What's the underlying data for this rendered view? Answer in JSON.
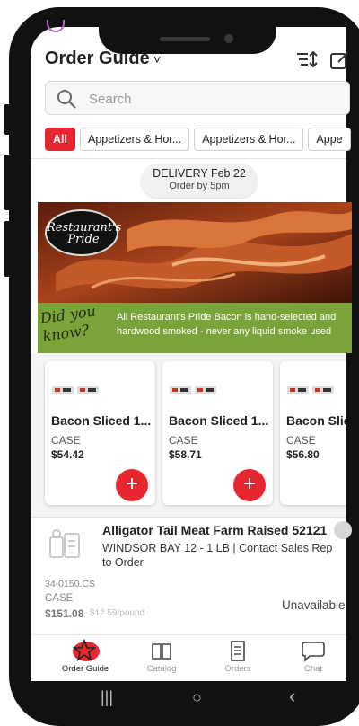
{
  "header": {
    "title": "Order Guide",
    "chevron": "˅"
  },
  "search": {
    "placeholder": "Search"
  },
  "filters": {
    "items": [
      "All",
      "Appetizers & Hor...",
      "Appetizers & Hor...",
      "Appe"
    ]
  },
  "delivery": {
    "line1": "DELIVERY Feb 22",
    "line2": "Order by 5pm"
  },
  "banner": {
    "brand": "Restaurant's Pride",
    "headline": "Did you know?",
    "line1": "All Restaurant's Pride Bacon is hand-selected and",
    "line2": "hardwood smoked - never any liquid smoke used"
  },
  "cards": [
    {
      "name": "Bacon Sliced 1...",
      "unit": "CASE",
      "price": "$54.42",
      "add": "+"
    },
    {
      "name": "Bacon Sliced 1...",
      "unit": "CASE",
      "price": "$58.71",
      "add": "+"
    },
    {
      "name": "Bacon Slic",
      "unit": "CASE",
      "price": "$56.80",
      "add": "+"
    }
  ],
  "list_item": {
    "title": "Alligator Tail Meat Farm Raised 52121",
    "desc": "WINDSOR BAY 12 - 1 LB | Contact Sales Rep to Order",
    "sku": "34-0150.CS",
    "unit": "CASE",
    "price": "$151.08",
    "per_unit": "$12.59/pound",
    "status": "Unavailable"
  },
  "tabs": [
    {
      "label": "Order Guide",
      "icon": "star-icon",
      "active": true
    },
    {
      "label": "Catalog",
      "icon": "book-icon"
    },
    {
      "label": "Orders",
      "icon": "receipt-icon"
    },
    {
      "label": "Chat",
      "icon": "chat-bubble-icon"
    }
  ],
  "android_nav": {
    "recents": "|||",
    "home": "○",
    "back": "‹"
  },
  "colors": {
    "accent": "#e8262f",
    "banner_band": "#7aa33a"
  }
}
